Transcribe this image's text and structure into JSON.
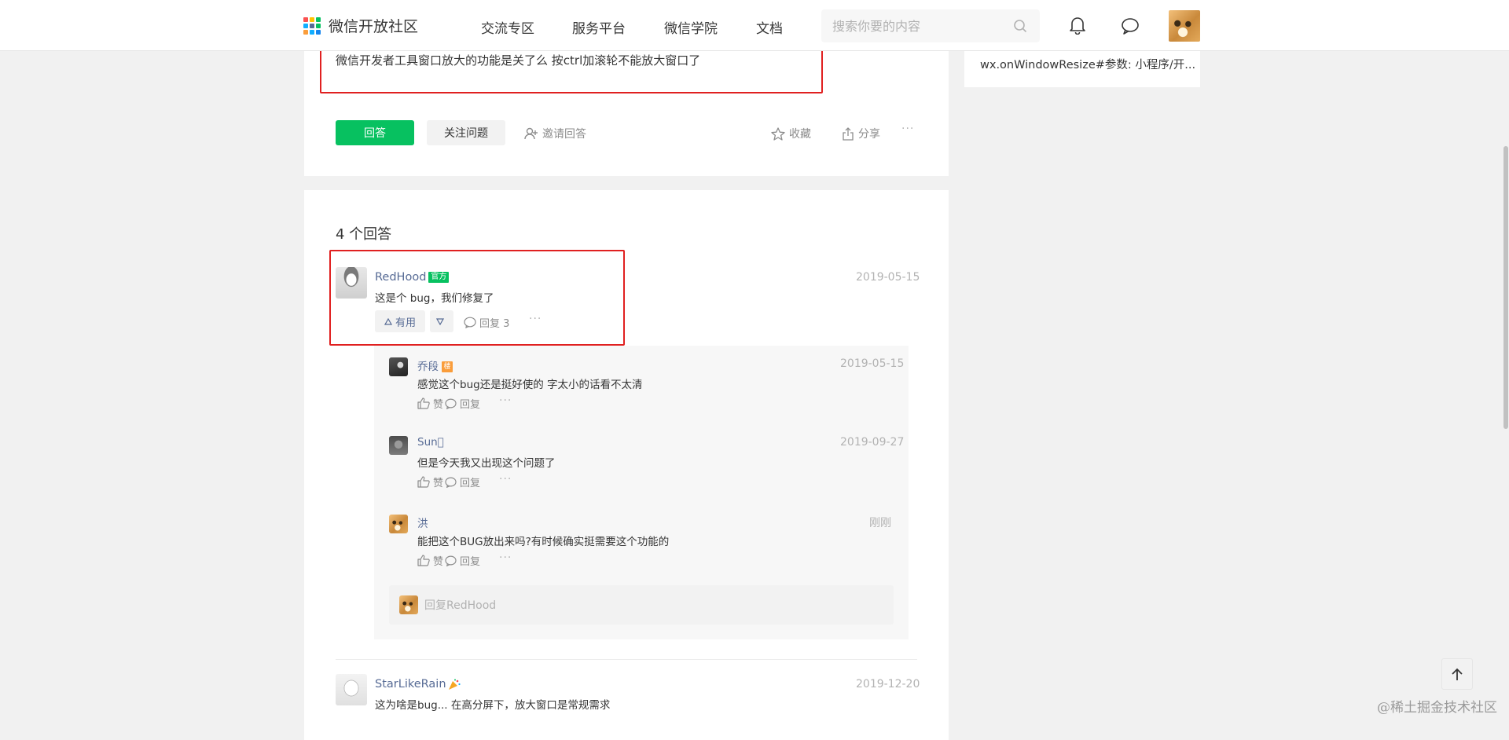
{
  "header": {
    "site_name": "微信开放社区",
    "nav": [
      "交流专区",
      "服务平台",
      "微信学院",
      "文档"
    ],
    "search_placeholder": "搜索你要的内容",
    "icons": [
      "bell-icon",
      "chat-bubble-icon"
    ],
    "logo_colors": [
      "#fa5151",
      "#ffc300",
      "#07c160",
      "#10aeff",
      "#576b95",
      "#07c160",
      "#fa9d3b",
      "#10aeff",
      "#1485ee"
    ]
  },
  "question": {
    "text": "微信开发者工具窗口放大的功能是关了么  按ctrl加滚轮不能放大窗口了",
    "answer_button": "回答",
    "follow_button": "关注问题",
    "invite": "邀请回答",
    "collect": "收藏",
    "share": "分享",
    "more": "···"
  },
  "sidebar": {
    "related": "wx.onWindowResize#参数: 小程序/开..."
  },
  "answers_section": {
    "count_label": "4 个回答",
    "answers": [
      {
        "user": "RedHood",
        "badge": "官方",
        "date": "2019-05-15",
        "text": "这是个 bug，我们修复了",
        "useful": "有用",
        "reply": "回复 3",
        "more": "···"
      },
      {
        "user": "StarLikeRain",
        "date": "2019-12-20",
        "text": "这为啥是bug... 在高分屏下，放大窗口是常规需求"
      }
    ],
    "comments": [
      {
        "user": "乔段",
        "level": "楼",
        "date": "2019-05-15",
        "text": "感觉这个bug还是挺好使的  字太小的话看不太清",
        "like": "赞",
        "reply": "回复",
        "more": "···"
      },
      {
        "user": "Sun🏻",
        "date": "2019-09-27",
        "text": "但是今天我又出现这个问题了",
        "like": "赞",
        "reply": "回复",
        "more": "···"
      },
      {
        "user": "洪",
        "date": "刚刚",
        "text": "能把这个BUG放出来吗?有时候确实挺需要这个功能的",
        "like": "赞",
        "reply": "回复",
        "more": "···"
      }
    ],
    "reply_placeholder": "回复RedHood"
  },
  "watermark": "@稀土掘金技术社区",
  "colors": {
    "brand_green": "#07c160",
    "link_blue": "#576b95",
    "highlight_red": "#e02020"
  }
}
